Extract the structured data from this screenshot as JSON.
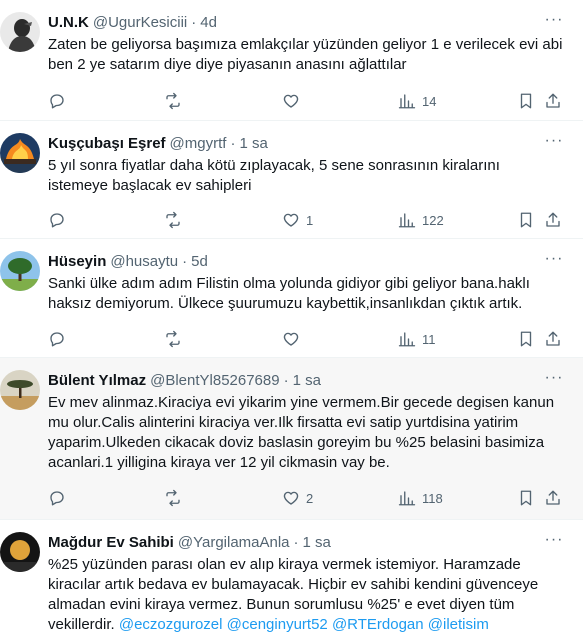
{
  "tweets": [
    {
      "name": "U.N.K",
      "handle": "@UgurKesiciii",
      "dot": "·",
      "time": "4d",
      "lines": [
        "Zaten be geliyorsa başımıza emlakçılar yüzünden geliyor 1 e verilecek evi abi",
        "ben 2 ye satarım diye diye piyasanın anasını ağlattılar"
      ],
      "replies": "",
      "retweets": "",
      "likes": "",
      "views": "14",
      "avatar_icon": "person-silhouette-avatar"
    },
    {
      "name": "Kuşçubaşı Eşref",
      "handle": "@mgyrtf",
      "dot": "·",
      "time": "1 sa",
      "lines": [
        "5 yıl sonra fiyatlar daha kötü zıplayacak, 5 sene sonrasının kiralarını",
        "istemeye başlacak ev sahipleri"
      ],
      "replies": "",
      "retweets": "",
      "likes": "1",
      "views": "122",
      "avatar_icon": "fire-ship-avatar"
    },
    {
      "name": "Hüseyin",
      "handle": "@husaytu",
      "dot": "·",
      "time": "5d",
      "lines": [
        "Sanki ülke adım adım Filistin olma yolunda gidiyor gibi geliyor bana.haklı",
        "haksız demiyorum. Ülkece şuurumuzu kaybettik,insanlıkdan çıktık artık."
      ],
      "replies": "",
      "retweets": "",
      "likes": "",
      "views": "11",
      "avatar_icon": "tree-landscape-avatar"
    },
    {
      "name": "Bülent Yılmaz",
      "handle": "@BlentYl85267689",
      "dot": "·",
      "time": "1 sa",
      "lines": [
        "Ev mev alinmaz.Kiraciya evi yikarim yine vermem.Bir gecede degisen kanun",
        "mu olur.Calis alinterini kiraciya ver.Ilk firsatta evi satip yurtdisina yatirim",
        "yaparim.Ulkeden cikacak doviz baslasin goreyim bu %25 belasini basimiza",
        "acanlari.1 yilligina kiraya ver 12 yil cikmasin vay be."
      ],
      "replies": "",
      "retweets": "",
      "likes": "2",
      "views": "118",
      "avatar_icon": "savanna-tree-avatar"
    },
    {
      "name": "Mağdur Ev Sahibi",
      "handle": "@YargilamaAnla",
      "dot": "·",
      "time": "1 sa",
      "lines": [
        "%25 yüzünden parası olan ev alıp kiraya vermek istemiyor. Haramzade",
        "kiracılar artık bedava ev bulamayacak. Hiçbir ev sahibi kendini güvenceye",
        "almadan evini kiraya vermez. Bunun sorumlusu %25' e evet diyen tüm"
      ],
      "last_line_prefix": "vekillerdir. ",
      "mentions": [
        "@eczozgurozel",
        "@cenginyurt52",
        "@RTErdogan",
        "@iletisim"
      ],
      "avatar_icon": "moon-night-avatar"
    }
  ],
  "more_glyph": "···",
  "colors": {
    "link": "#1d9bf0",
    "secondary": "#536471",
    "hover_bg": "#f7f7f7"
  }
}
